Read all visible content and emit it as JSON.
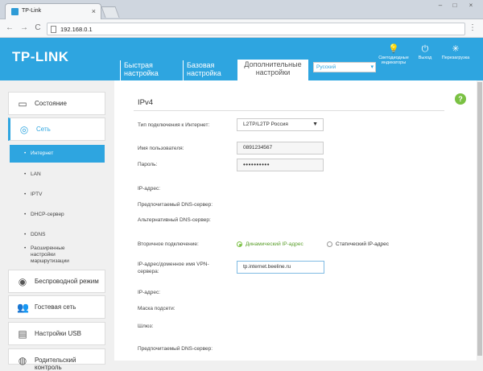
{
  "browser": {
    "tab_title": "TP-Link",
    "tab_close": "×",
    "url": "192.168.0.1",
    "back": "←",
    "forward": "→",
    "reload": "C",
    "menu": "⋮",
    "win_minimize": "–",
    "win_maximize": "□",
    "win_close": "×"
  },
  "header": {
    "logo": "TP-LINK",
    "tabs": [
      {
        "line1": "Быстрая",
        "line2": "настройка"
      },
      {
        "line1": "Базовая",
        "line2": "настройка"
      },
      {
        "line1": "Дополнительные",
        "line2": "настройки"
      }
    ],
    "language": "Русский",
    "icons": [
      {
        "glyph": "💡",
        "label": "Светодиодные индикаторы"
      },
      {
        "glyph": "⏻",
        "label": "Выход"
      },
      {
        "glyph": "✳",
        "label": "Перезагрузка"
      }
    ]
  },
  "sidebar": {
    "items": [
      {
        "label": "Состояние",
        "icon": "▭"
      },
      {
        "label": "Сеть",
        "icon": "◎"
      },
      {
        "label": "Беспроводной режим",
        "icon": "◉"
      },
      {
        "label": "Гостевая сеть",
        "icon": "👥"
      },
      {
        "label": "Настройки USB",
        "icon": "▤"
      },
      {
        "label": "Родительский контроль",
        "icon": "◍"
      }
    ],
    "sub_items": [
      "Интернет",
      "LAN",
      "IPTV",
      "DHCP-сервер",
      "DDNS",
      "Расширенные настройки маршрутизации"
    ]
  },
  "content": {
    "section_title": "IPv4",
    "help": "?",
    "connection_type_label": "Тип подключения к Интернет:",
    "connection_type_value": "L2TP/L2TP Россия",
    "username_label": "Имя пользователя:",
    "username_value": "0891234567",
    "password_label": "Пароль:",
    "password_value": "••••••••••",
    "ip_label": "IP-адрес:",
    "dns1_label": "Предпочитаемый DNS-сервер:",
    "dns2_label": "Альтернативный DNS-сервер:",
    "secondary_label": "Вторичное подключение:",
    "radio_dynamic": "Динамический IP-адрес",
    "radio_static": "Статический IP-адрес",
    "vpn_label_1": "IP-адрес/доменное имя VPN-",
    "vpn_label_2": "сервера:",
    "vpn_value": "tp.internet.beeline.ru",
    "ip2_label": "IP-адрес:",
    "mask_label": "Маска подсети:",
    "gateway_label": "Шлюз:",
    "dns3_label": "Предпочитаемый DNS-сервер:"
  },
  "colors": {
    "brand_blue": "#2ea5e0",
    "accent_green": "#7ac143"
  }
}
